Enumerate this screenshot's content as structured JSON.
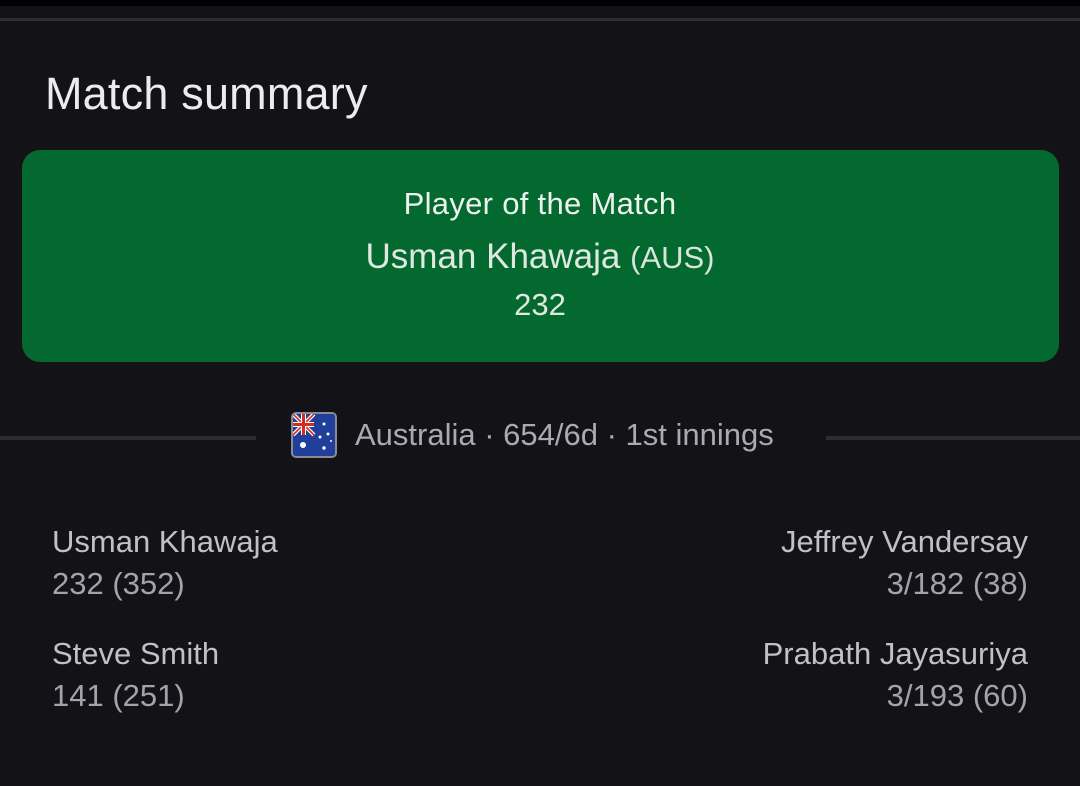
{
  "header": {
    "title": "Match summary"
  },
  "player_of_match": {
    "label": "Player of the Match",
    "name": "Usman Khawaja",
    "team": "(AUS)",
    "score": "232"
  },
  "innings": {
    "flag_icon": "australia-flag-icon",
    "text": "Australia · 654/6d · 1st innings"
  },
  "batters": [
    {
      "name": "Usman Khawaja",
      "stat": "232 (352)"
    },
    {
      "name": "Steve Smith",
      "stat": "141 (251)"
    }
  ],
  "bowlers": [
    {
      "name": "Jeffrey Vandersay",
      "stat": "3/182 (38)"
    },
    {
      "name": "Prabath Jayasuriya",
      "stat": "3/193 (60)"
    }
  ],
  "colors": {
    "background": "#121217",
    "potm_card": "#04692e",
    "divider": "#2b2c31"
  }
}
